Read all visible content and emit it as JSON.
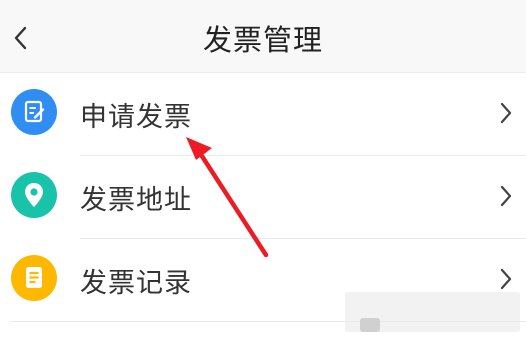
{
  "header": {
    "title": "发票管理",
    "back_icon": "chevron-left-icon"
  },
  "menu": [
    {
      "label": "申请发票",
      "icon": "apply-invoice-icon",
      "icon_color": "#2f8df3",
      "chevron": "chevron-right-icon"
    },
    {
      "label": "发票地址",
      "icon": "location-pin-icon",
      "icon_color": "#19c3a9",
      "chevron": "chevron-right-icon"
    },
    {
      "label": "发票记录",
      "icon": "record-list-icon",
      "icon_color": "#ffb800",
      "chevron": "chevron-right-icon"
    }
  ],
  "annotation": {
    "arrow_color": "#ec1b24"
  }
}
